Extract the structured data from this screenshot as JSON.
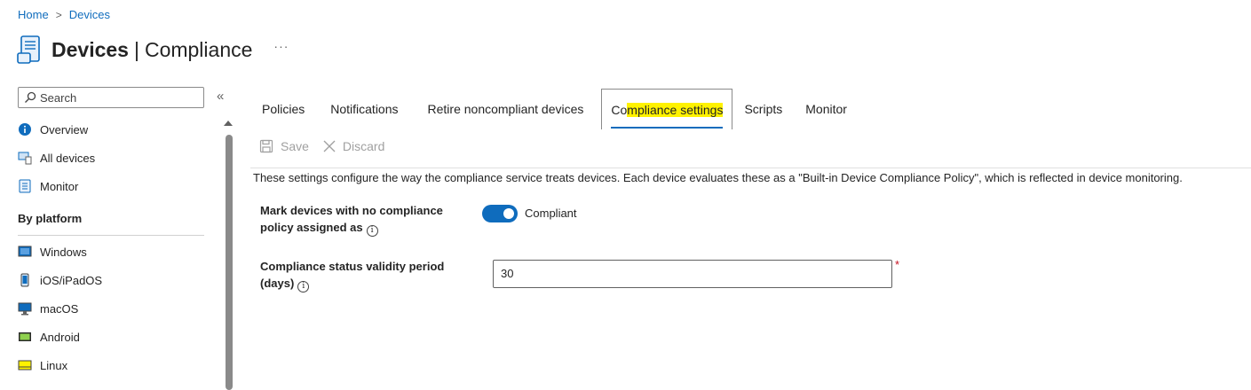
{
  "breadcrumb": {
    "home": "Home",
    "separator": ">",
    "current": "Devices"
  },
  "header": {
    "title_main": "Devices",
    "title_pipe": "|",
    "title_sub": "Compliance",
    "more": "···"
  },
  "sidebar": {
    "search_placeholder": "Search",
    "collapse": "«",
    "items": [
      {
        "label": "Overview",
        "icon": "info-icon"
      },
      {
        "label": "All devices",
        "icon": "devices-icon"
      },
      {
        "label": "Monitor",
        "icon": "monitor-icon"
      }
    ],
    "section": "By platform",
    "platforms": [
      {
        "label": "Windows",
        "icon": "windows-icon"
      },
      {
        "label": "iOS/iPadOS",
        "icon": "phone-icon"
      },
      {
        "label": "macOS",
        "icon": "desktop-icon"
      },
      {
        "label": "Android",
        "icon": "android-icon"
      },
      {
        "label": "Linux",
        "icon": "linux-icon"
      }
    ]
  },
  "tabs": {
    "policies": "Policies",
    "notifications": "Notifications",
    "retire": "Retire noncompliant devices",
    "compliance_settings_pre": "Co",
    "compliance_settings_hl": "mpliance settings",
    "scripts": "Scripts",
    "monitor": "Monitor"
  },
  "toolbar": {
    "save": "Save",
    "discard": "Discard"
  },
  "description": "These settings configure the way the compliance service treats devices. Each device evaluates these as a \"Built-in Device Compliance Policy\", which is reflected in device monitoring.",
  "form": {
    "mark_label_line1": "Mark devices with no compliance",
    "mark_label_line2": "policy assigned as",
    "mark_value": "Compliant",
    "validity_label_line1": "Compliance status validity period",
    "validity_label_line2": "(days)",
    "validity_value": "30",
    "required_mark": "*"
  },
  "colors": {
    "accent": "#0f6cbd",
    "highlight": "#fff200",
    "required": "#c50f1f"
  }
}
